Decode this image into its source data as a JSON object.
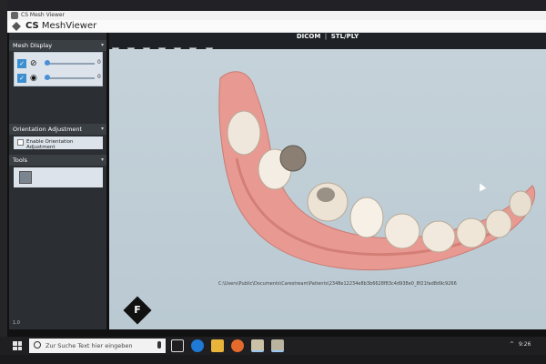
{
  "window": {
    "title": "CS Mesh Viewer"
  },
  "app": {
    "brand_prefix": "CS",
    "brand_name": "MeshViewer"
  },
  "left_panel": {
    "mesh_display": {
      "title": "Mesh Display",
      "rows": [
        {
          "checked": true,
          "eye_icon": "eye-off-icon",
          "value": "0"
        },
        {
          "checked": true,
          "eye_icon": "eye-icon",
          "value": "0"
        }
      ]
    },
    "orientation": {
      "title": "Orientation Adjustment",
      "checkbox_label": "Enable Orientation Adjustment"
    },
    "tools": {
      "title": "Tools"
    },
    "version": "1.0"
  },
  "toolbar": {
    "tabs": [
      "DICOM",
      "STL/PLY"
    ],
    "icons": [
      "camera-icon",
      "cube-view-icon",
      "cube-front-icon",
      "cube-side-icon",
      "cube-top-icon",
      "cube-bottom-icon",
      "cube-iso-icon"
    ]
  },
  "viewport": {
    "orientation_cube_label": "F",
    "file_path": "C:\\Users\\Public\\Documents\\Carestream\\Patients\\2348e12234e8b3b6628f83c4d938e0_8f21fad8d9c9266"
  },
  "taskbar": {
    "search_placeholder": "Zur Suche Text hier eingeben",
    "apps": [
      "task-view-icon",
      "edge-icon",
      "file-explorer-icon",
      "firefox-icon",
      "meshviewer-app-icon",
      "meshviewer-app-icon-2"
    ],
    "tray": [
      "^",
      "9:26"
    ]
  },
  "colors": {
    "accent": "#3b8fd1",
    "panel": "#2b2f33",
    "viewport_bg": "#c5d2da"
  }
}
